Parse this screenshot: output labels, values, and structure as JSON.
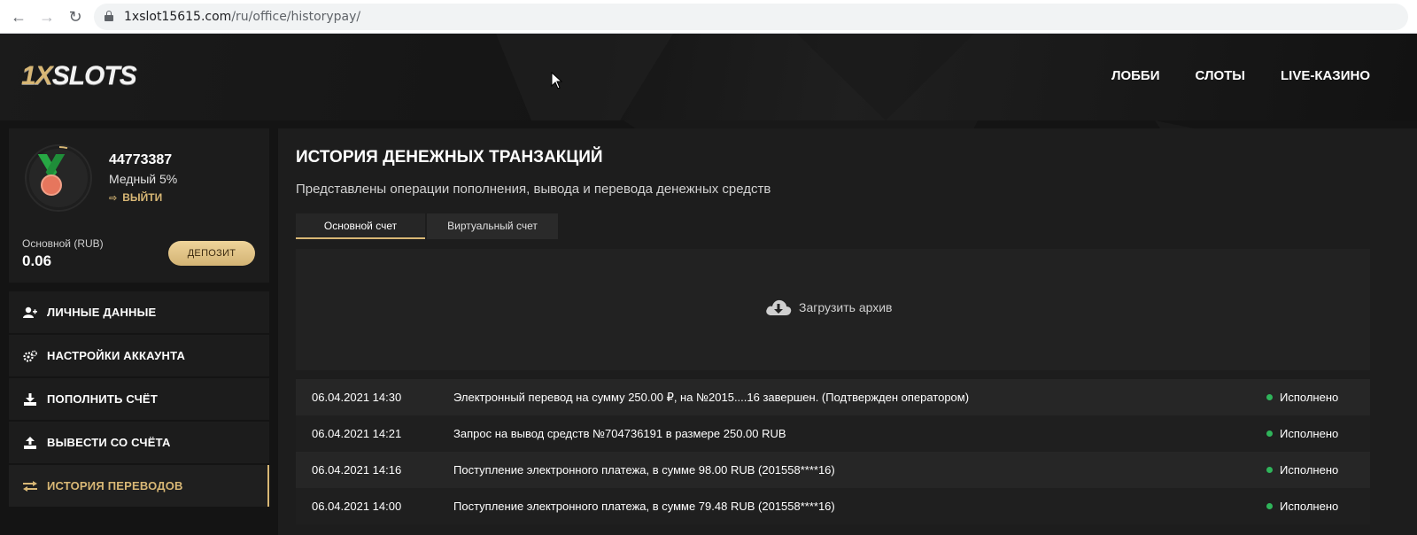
{
  "browser": {
    "url_domain": "1xslot15615.com",
    "url_path": "/ru/office/historypay/"
  },
  "header": {
    "logo_prefix": "1X",
    "logo_suffix": "SLOTS",
    "nav": [
      "ЛОББИ",
      "СЛОТЫ",
      "LIVE-КАЗИНО"
    ]
  },
  "profile": {
    "user_id": "44773387",
    "level": "Медный 5%",
    "logout_label": "ВЫЙТИ",
    "balance_label": "Основной (RUB)",
    "balance_value": "0.06",
    "deposit_label": "ДЕПОЗИТ"
  },
  "sidebar": {
    "items": [
      {
        "label": "ЛИЧНЫЕ ДАННЫЕ",
        "icon": "user-add-icon"
      },
      {
        "label": "НАСТРОЙКИ АККАУНТА",
        "icon": "gears-icon"
      },
      {
        "label": "ПОПОЛНИТЬ СЧЁТ",
        "icon": "download-icon"
      },
      {
        "label": "ВЫВЕСТИ СО СЧЁТА",
        "icon": "upload-icon"
      },
      {
        "label": "ИСТОРИЯ ПЕРЕВОДОВ",
        "icon": "transfer-arrows-icon",
        "active": true
      }
    ]
  },
  "main": {
    "title": "ИСТОРИЯ ДЕНЕЖНЫХ ТРАНЗАКЦИЙ",
    "subtitle": "Представлены операции пополнения, вывода и перевода денежных средств",
    "tabs": [
      {
        "label": "Основной счет",
        "active": true
      },
      {
        "label": "Виртуальный счет",
        "active": false
      }
    ],
    "archive_label": "Загрузить архив",
    "transactions": [
      {
        "date": "06.04.2021 14:30",
        "description": "Электронный перевод на сумму 250.00 ₽, на №2015....16 завершен. (Подтвержден оператором)",
        "status": "Исполнено"
      },
      {
        "date": "06.04.2021 14:21",
        "description": "Запрос на вывод средств №704736191 в размере 250.00 RUB",
        "status": "Исполнено"
      },
      {
        "date": "06.04.2021 14:16",
        "description": "Поступление электронного платежа, в сумме 98.00 RUB (201558****16)",
        "status": "Исполнено"
      },
      {
        "date": "06.04.2021 14:00",
        "description": "Поступление электронного платежа, в сумме 79.48 RUB (201558****16)",
        "status": "Исполнено"
      }
    ]
  },
  "colors": {
    "accent_gold": "#d8b775",
    "status_green": "#2fb45a",
    "background": "#141414"
  }
}
